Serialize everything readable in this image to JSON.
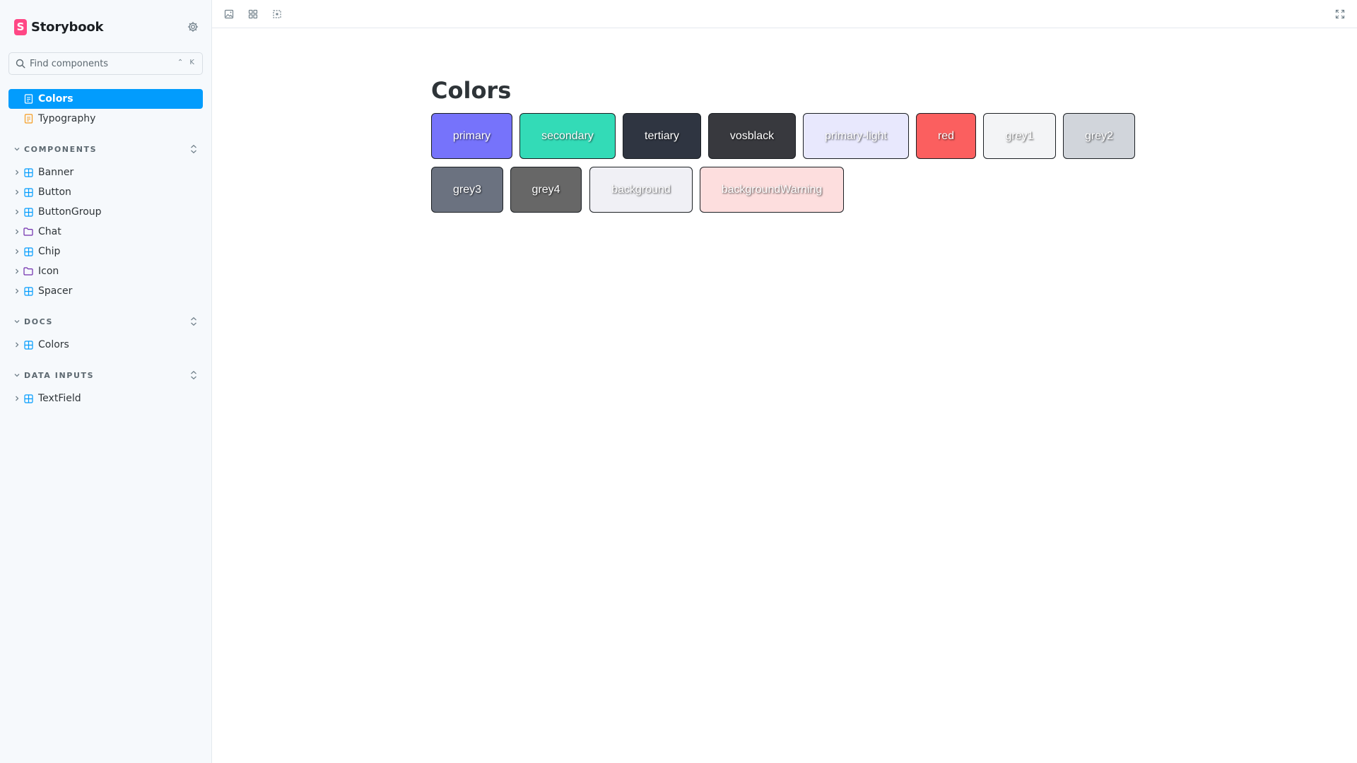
{
  "sidebar": {
    "brand": {
      "name": "Storybook",
      "logo_letter": "S",
      "logo_color": "#ff4785"
    },
    "search": {
      "placeholder": "Find components",
      "shortcut": "⌃ K"
    },
    "top_items": [
      {
        "label": "Colors",
        "active": true
      },
      {
        "label": "Typography",
        "active": false
      }
    ],
    "sections": [
      {
        "title": "COMPONENTS",
        "items": [
          {
            "label": "Banner",
            "icon": "component-icon"
          },
          {
            "label": "Button",
            "icon": "component-icon"
          },
          {
            "label": "ButtonGroup",
            "icon": "component-icon"
          },
          {
            "label": "Chat",
            "icon": "folder-icon"
          },
          {
            "label": "Chip",
            "icon": "component-icon"
          },
          {
            "label": "Icon",
            "icon": "folder-icon"
          },
          {
            "label": "Spacer",
            "icon": "component-icon"
          }
        ]
      },
      {
        "title": "DOCS",
        "items": [
          {
            "label": "Colors",
            "icon": "component-icon"
          }
        ]
      },
      {
        "title": "DATA INPUTS",
        "items": [
          {
            "label": "TextField",
            "icon": "component-icon"
          }
        ]
      }
    ],
    "accent_color": "#029cfd"
  },
  "toolbar": {
    "tools": [
      "image-icon",
      "grid-icon",
      "outline-icon"
    ],
    "fullscreen_icon": "fullscreen-icon"
  },
  "main": {
    "title": "Colors",
    "swatches": [
      {
        "name": "primary",
        "color": "#7673fb"
      },
      {
        "name": "secondary",
        "color": "#33dbb7"
      },
      {
        "name": "tertiary",
        "color": "#2f3541"
      },
      {
        "name": "vosblack",
        "color": "#38393e"
      },
      {
        "name": "primary-light",
        "color": "#e8e8fd"
      },
      {
        "name": "red",
        "color": "#fb5f5f"
      },
      {
        "name": "grey1",
        "color": "#f3f4f6"
      },
      {
        "name": "grey2",
        "color": "#d1d5db"
      },
      {
        "name": "grey3",
        "color": "#6b7280"
      },
      {
        "name": "grey4",
        "color": "#676767"
      },
      {
        "name": "background",
        "color": "#f0f0f5"
      },
      {
        "name": "backgroundWarning",
        "color": "#fddede"
      }
    ]
  }
}
